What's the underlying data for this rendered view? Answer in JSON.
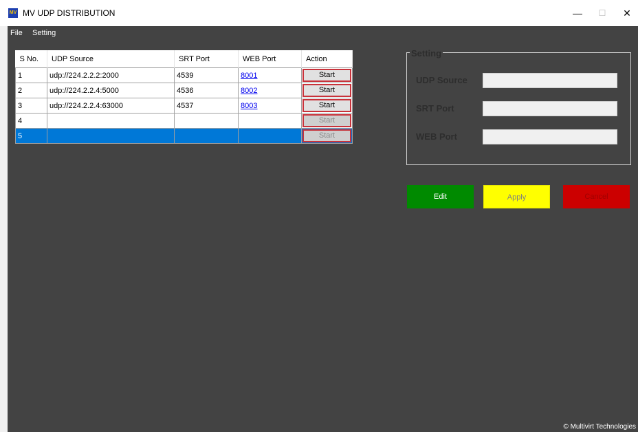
{
  "window": {
    "title": "MV UDP DISTRIBUTION",
    "icon_label": "MV",
    "minimize_glyph": "—",
    "maximize_glyph": "☐",
    "close_glyph": "✕"
  },
  "menu": {
    "items": [
      "File",
      "Setting"
    ]
  },
  "table": {
    "headers": [
      "S No.",
      "UDP Source",
      "SRT Port",
      "WEB Port",
      "Action"
    ],
    "rows": [
      {
        "sno": "1",
        "udp_source": "udp://224.2.2.2:2000",
        "srt_port": "4539",
        "web_port": "8001",
        "action": "Start"
      },
      {
        "sno": "2",
        "udp_source": "udp://224.2.2.4:5000",
        "srt_port": "4536",
        "web_port": "8002",
        "action": "Start"
      },
      {
        "sno": "3",
        "udp_source": "udp://224.2.2.4:63000",
        "srt_port": "4537",
        "web_port": "8003",
        "action": "Start"
      },
      {
        "sno": "4",
        "udp_source": "",
        "srt_port": "",
        "web_port": "",
        "action": "Start"
      },
      {
        "sno": "5",
        "udp_source": "",
        "srt_port": "",
        "web_port": "",
        "action": "Start"
      }
    ],
    "selected_row": "5"
  },
  "setting": {
    "legend": "Setting",
    "udp_source_label": "UDP Source",
    "udp_source_value": "",
    "srt_port_label": "SRT Port",
    "srt_port_value": "",
    "web_port_label": "WEB Port",
    "web_port_value": ""
  },
  "buttons": {
    "edit": "Edit",
    "apply": "Apply",
    "cancel": "Cancel"
  },
  "footer": "© Multivirt Technologies",
  "colors": {
    "app_background": "#434343",
    "selection": "#0078d7",
    "edit_button": "#008a00",
    "apply_button": "#ffff00",
    "cancel_button": "#cc0000",
    "start_border": "#c8323a"
  }
}
